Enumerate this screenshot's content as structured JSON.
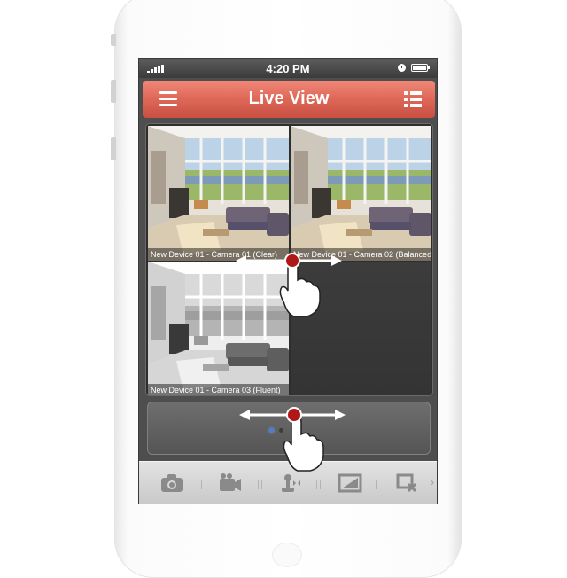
{
  "statusbar": {
    "time": "4:20 PM"
  },
  "navbar": {
    "title": "Live View",
    "left_icon": "menu-icon",
    "right_icon": "channel-list-icon"
  },
  "cameras": [
    {
      "caption": "New Device 01 - Camera 01 (Clear)",
      "selected": true,
      "color": "color"
    },
    {
      "caption": "New Device 01 - Camera 02 (Balanced)",
      "selected": false,
      "color": "color"
    },
    {
      "caption": "New Device 01 - Camera 03 (Fluent)",
      "selected": false,
      "color": "grayscale"
    }
  ],
  "pager": {
    "page_count": 2,
    "current_page": 1
  },
  "toolbar": {
    "items": [
      "camera-icon",
      "video-record-icon",
      "ptz-control-icon",
      "image-quality-icon",
      "close-all-icon"
    ]
  },
  "colors": {
    "navbar_accent": "#e06a5a",
    "selected_border": "#d8b040",
    "active_dot": "#4a7fd0",
    "gesture_touch": "#b01818"
  }
}
